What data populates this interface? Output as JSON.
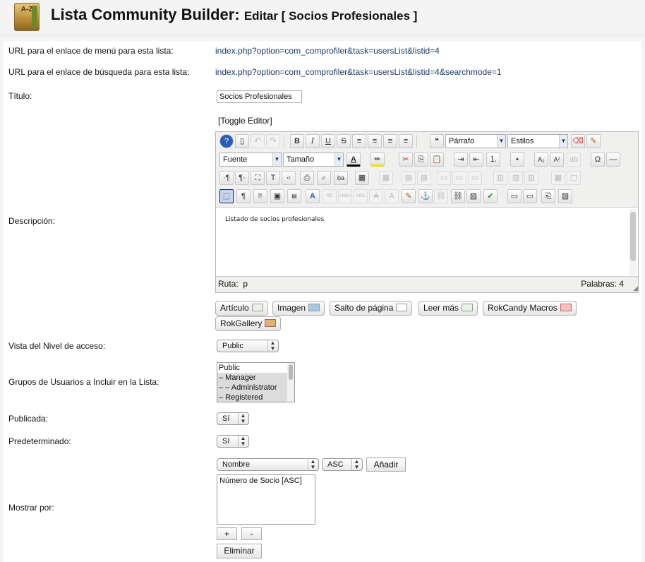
{
  "header": {
    "title": "Lista Community Builder:",
    "subtitle": "Editar [ Socios Profesionales ]",
    "logo_text": "A-Z"
  },
  "fields": {
    "menu_url_label": "URL para el enlace de menú para esta lista:",
    "menu_url_value": "index.php?option=com_comprofiler&task=usersList&listid=4",
    "search_url_label": "URL para el enlace de búsqueda para esta lista:",
    "search_url_value": "index.php?option=com_comprofiler&task=usersList&listid=4&searchmode=1",
    "title_label": "Título:",
    "title_value": "Socios Profesionales",
    "description_label": "Descripción:",
    "access_label": "Vista del Nivel de acceso:",
    "access_value": "Public",
    "groups_label": "Grupos de Usuarios a Incluir en la Lista:",
    "groups_options": [
      "Public",
      "– Manager",
      "– – Administrator",
      "– Registered"
    ],
    "published_label": "Publicada:",
    "published_value": "Sí",
    "default_label": "Predeterminado:",
    "default_value": "Sí",
    "sort_label": "Mostrar por:",
    "sort_field_value": "Nombre",
    "sort_dir_value": "ASC",
    "add_label": "Añadir",
    "sort_list_items": [
      "Número de Socio [ASC]"
    ],
    "plus_label": "+",
    "minus_label": "-",
    "remove_label": "Eliminar"
  },
  "editor": {
    "toggle_label": "[Toggle Editor]",
    "format_select": "Párrafo",
    "styles_select": "Estilos",
    "font_select": "Fuente",
    "size_select": "Tamaño",
    "content_text": "Listado de socios profesionales",
    "path_label": "Ruta:",
    "path_value": "p",
    "words_label": "Palabras:",
    "words_value": "4"
  },
  "buttons": {
    "article": "Artículo",
    "image": "Imagen",
    "pagebreak": "Salto de página",
    "readmore": "Leer más",
    "rokcandy": "RokCandy Macros",
    "rokgallery": "RokGallery"
  },
  "colors": {
    "link": "#1a3a66",
    "page_bg": "#f4f4f4",
    "panel_bg": "#ffffff"
  }
}
